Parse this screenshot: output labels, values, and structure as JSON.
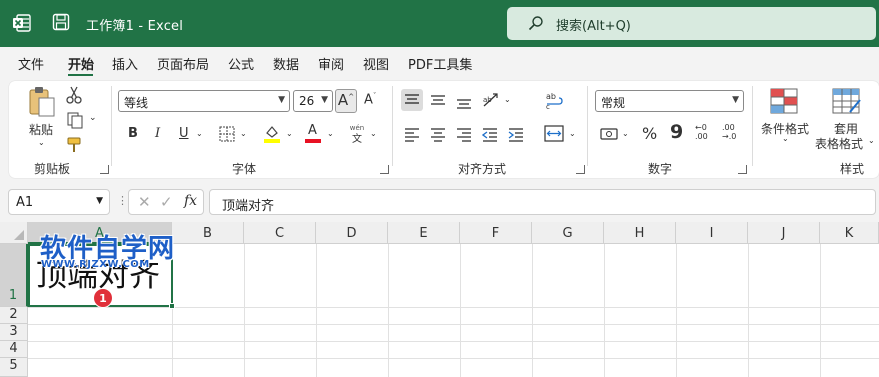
{
  "titlebar": {
    "app_title": "工作簿1  -  Excel",
    "search_text": "搜索(Alt+Q)",
    "accent": "#217346"
  },
  "menu": {
    "items": [
      "文件",
      "开始",
      "插入",
      "页面布局",
      "公式",
      "数据",
      "审阅",
      "视图",
      "PDF工具集"
    ],
    "active": "开始"
  },
  "ribbon": {
    "clipboard": {
      "paste_label": "粘贴",
      "group_label": "剪贴板"
    },
    "font": {
      "font_name": "等线",
      "font_size": "26",
      "bold": "B",
      "italic": "I",
      "underline": "U",
      "group_label": "字体",
      "font_color": "#e81123",
      "highlight_color": "#ffff00",
      "wen_top": "wén",
      "wen_bottom": "文"
    },
    "alignment": {
      "group_label": "对齐方式"
    },
    "number": {
      "format": "常规",
      "percent": "%",
      "comma": "9",
      "dec_inc_top": "←0",
      "dec_inc_bottom": ".00",
      "dec_dec_top": ".00",
      "dec_dec_bottom": "→.0",
      "group_label": "数字"
    },
    "styles": {
      "cond_format_label": "条件格式",
      "table_format_line1": "套用",
      "table_format_line2": "表格格式",
      "group_label": "样式"
    }
  },
  "formula_bar": {
    "name_box": "A1",
    "fx_label": "fx",
    "content": "顶端对齐"
  },
  "sheet": {
    "columns": [
      "B",
      "C",
      "D",
      "E",
      "F",
      "G",
      "H",
      "I",
      "J",
      "K"
    ],
    "rows": [
      "1",
      "2",
      "3",
      "4",
      "5"
    ],
    "a1_value": "顶端对齐",
    "col_a_label": "A",
    "selected_cell": "A1"
  },
  "watermark": {
    "line1": "软件自学网",
    "line2": "WWW.RJZXW.COM"
  },
  "annotation": {
    "badge": "1",
    "color": "#e0303a"
  }
}
